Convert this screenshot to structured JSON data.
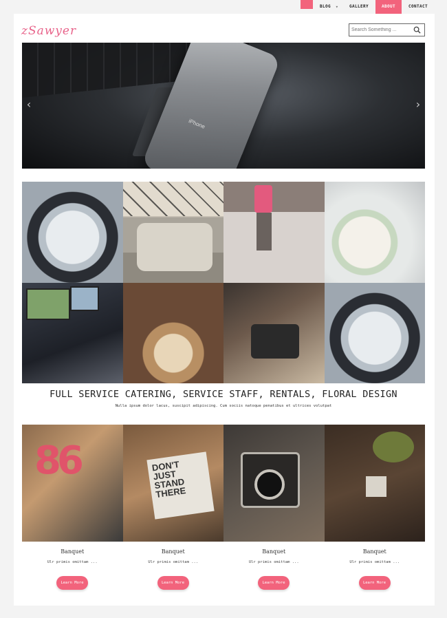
{
  "nav": {
    "items": [
      {
        "label": "BLOG"
      },
      {
        "label": "GALLERY"
      },
      {
        "label": "ABOUT",
        "active": true
      },
      {
        "label": "CONTACT"
      }
    ],
    "dropdown_arrow": "▾",
    "accent_color": "#f2637c"
  },
  "header": {
    "logo": "zSawyer",
    "search_placeholder": "Search Something ...",
    "search_icon": "search-icon"
  },
  "hero": {
    "phone_label": "iPhone",
    "prev_icon": "chevron-left-icon",
    "next_icon": "chevron-right-icon"
  },
  "tagline": {
    "title": "FULL SERVICE CATERING, SERVICE STAFF, RENTALS, FLORAL DESIGN",
    "subtitle": "Nulla ipsum dolor lacus, suscipit adipiscing. Cum sociis natoque penatibus et ultrices volutpat"
  },
  "cards": [
    {
      "title": "Banquet",
      "text": "Ulr primis omittam ...",
      "button": "Learn More"
    },
    {
      "title": "Banquet",
      "text": "Ulr primis omittam ...",
      "button": "Learn More"
    },
    {
      "title": "Banquet",
      "text": "Ulr primis omittam ...",
      "button": "Learn More"
    },
    {
      "title": "Banquet",
      "text": "Ulr primis omittam ...",
      "button": "Learn More"
    }
  ]
}
